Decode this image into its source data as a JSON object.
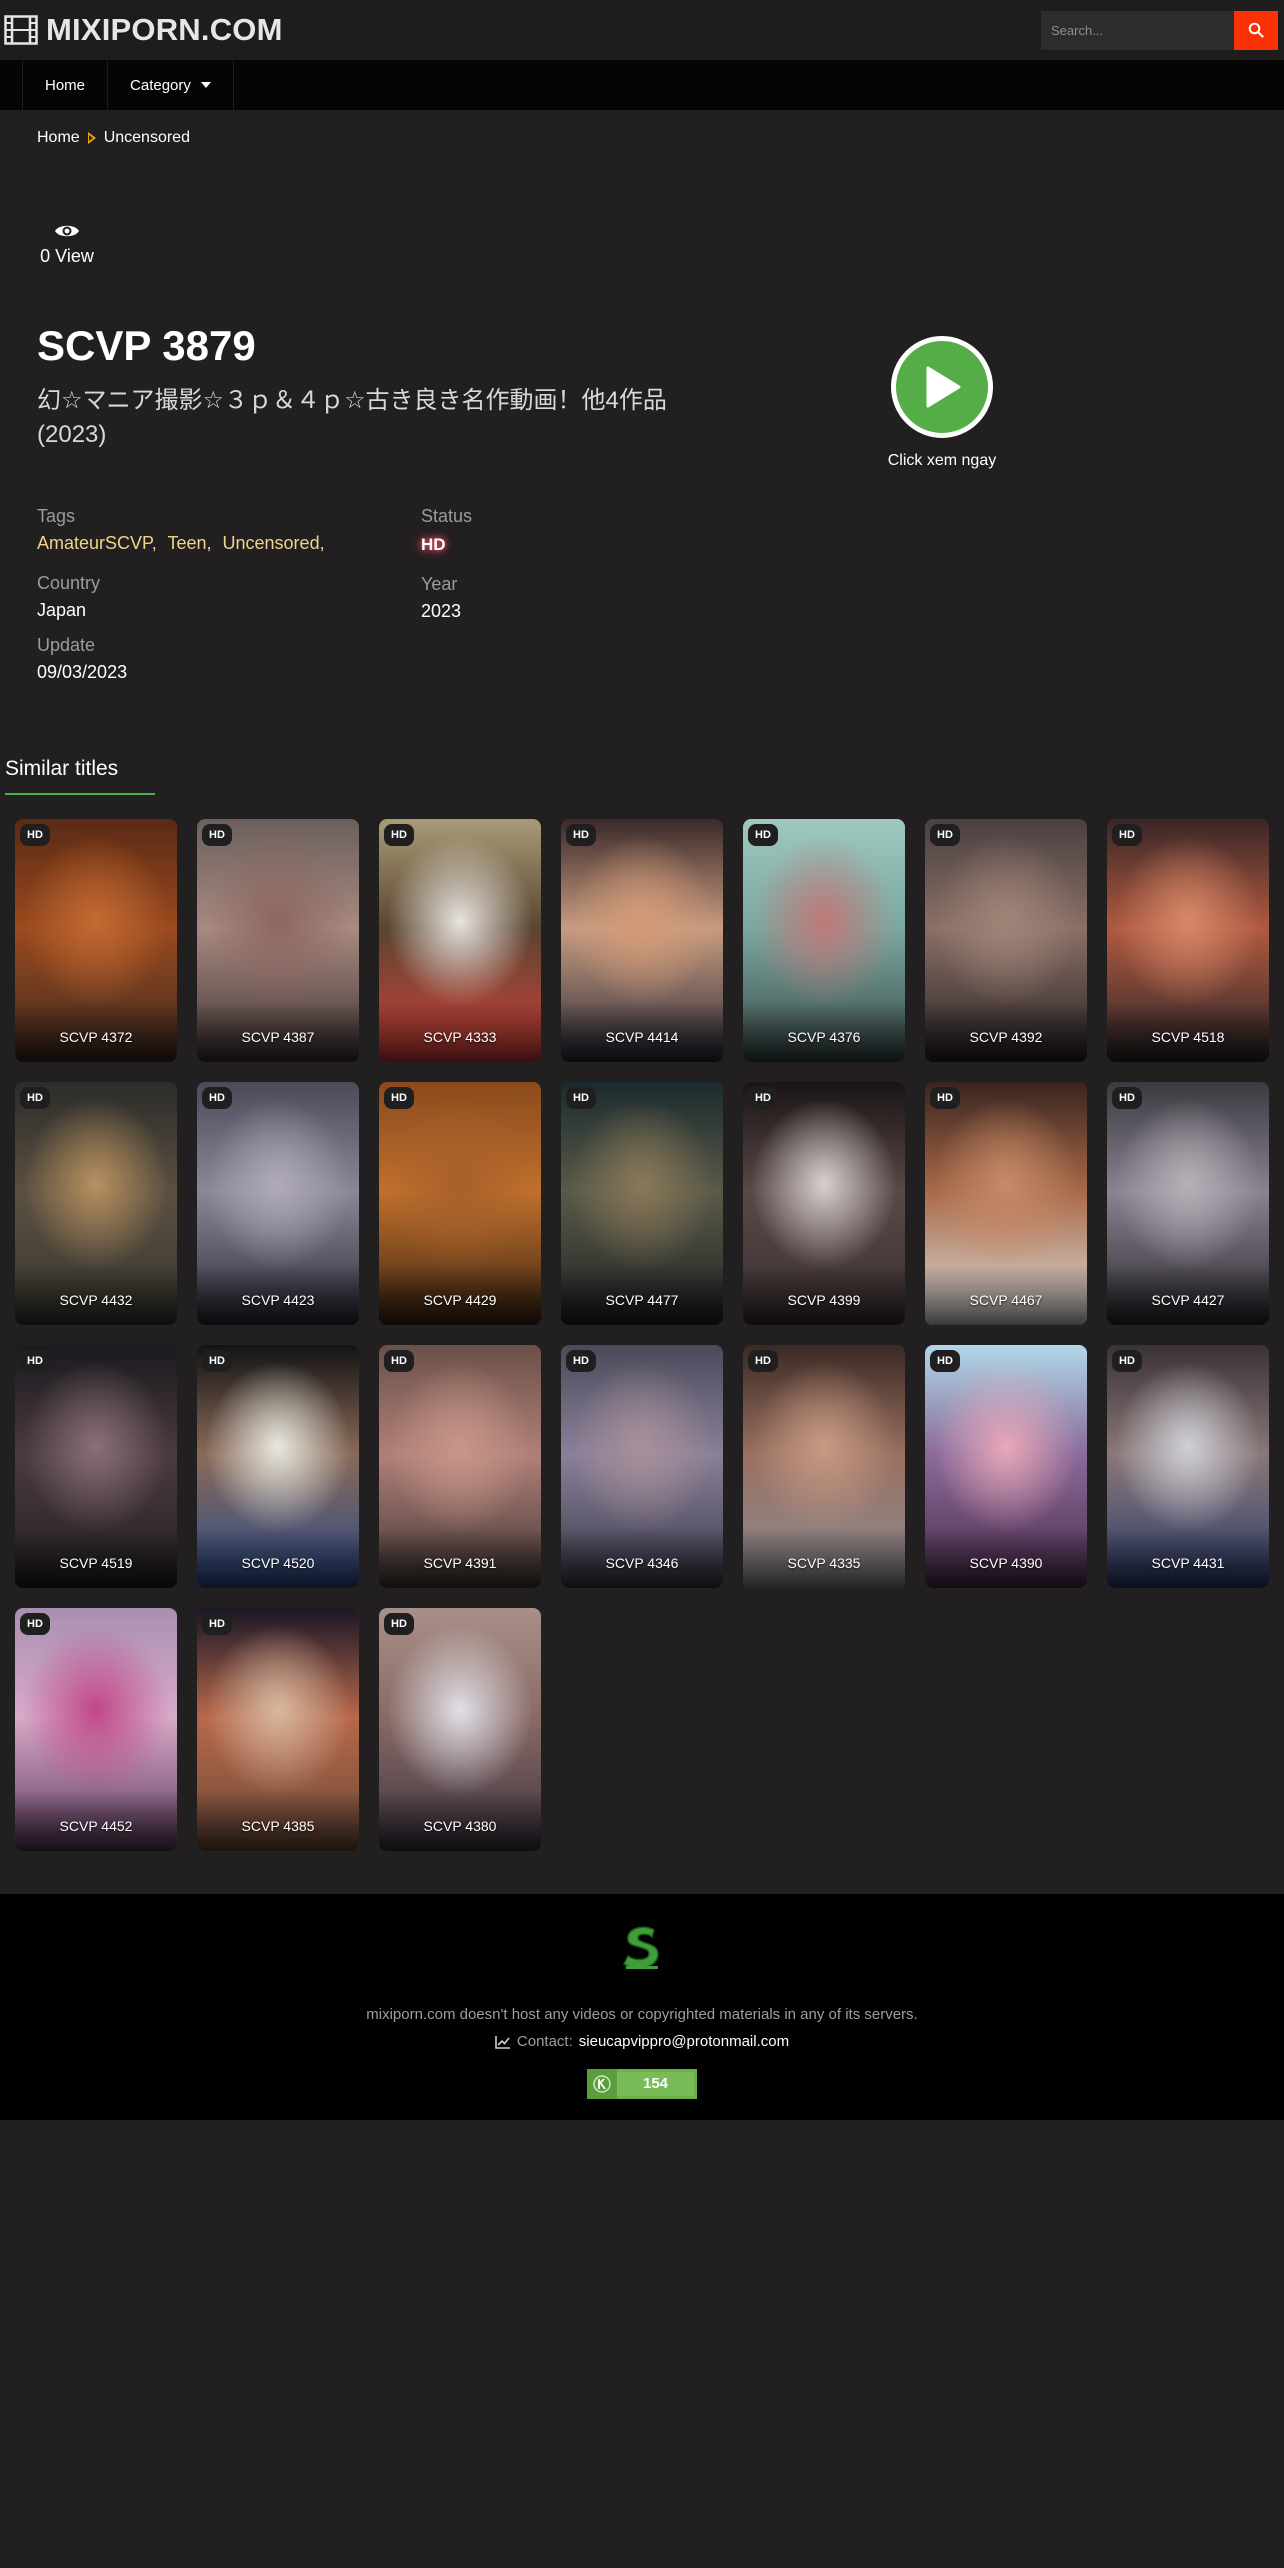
{
  "header": {
    "logo_text": "MIXIPORN.COM",
    "logo_icon": "film-icon",
    "search_placeholder": "Search...",
    "search_icon": "search-icon",
    "accent_color": "#fa3203"
  },
  "nav": {
    "items": [
      {
        "label": "Home"
      },
      {
        "label": "Category"
      }
    ]
  },
  "breadcrumb": {
    "home": "Home",
    "current": "Uncensored"
  },
  "movie": {
    "views": "0 View",
    "title": "SCVP 3879",
    "subtitle": "幻☆マニア撮影☆３ｐ＆４ｐ☆古き良き名作動画！他4作品 (2023)",
    "play_label": "Click xem ngay",
    "tags_label": "Tags",
    "tags": [
      "AmateurSCVP",
      "Teen",
      "Uncensored"
    ],
    "status_label": "Status",
    "status": "HD",
    "country_label": "Country",
    "country": "Japan",
    "year_label": "Year",
    "year": "2023",
    "update_label": "Update",
    "update": "09/03/2023"
  },
  "similar": {
    "heading": "Similar titles",
    "badge": "HD",
    "items": [
      {
        "title": "SCVP 4372",
        "colors": [
          "#5a2a14",
          "#9a4a1e",
          "#c46a32",
          "#3d2a22"
        ]
      },
      {
        "title": "SCVP 4387",
        "colors": [
          "#6b5f5c",
          "#a88a80",
          "#8c6660",
          "#3e3233"
        ]
      },
      {
        "title": "SCVP 4333",
        "colors": [
          "#a89b78",
          "#5a4530",
          "#e8e4e0",
          "#d8403a"
        ]
      },
      {
        "title": "SCVP 4414",
        "colors": [
          "#3a2a2a",
          "#c89c80",
          "#d49a78",
          "#2a2a38"
        ]
      },
      {
        "title": "SCVP 4376",
        "colors": [
          "#9ec8c0",
          "#7aa8a0",
          "#c07878",
          "#3a4848"
        ]
      },
      {
        "title": "SCVP 4392",
        "colors": [
          "#4a4040",
          "#8a7066",
          "#a08478",
          "#262024"
        ]
      },
      {
        "title": "SCVP 4518",
        "colors": [
          "#3a2626",
          "#b05a40",
          "#d88868",
          "#2a2428"
        ]
      },
      {
        "title": "SCVP 4432",
        "colors": [
          "#2c2c2a",
          "#5a5040",
          "#b89060",
          "#383630"
        ]
      },
      {
        "title": "SCVP 4423",
        "colors": [
          "#4a4a5a",
          "#8a8898",
          "#b0aab8",
          "#2a2a36"
        ]
      },
      {
        "title": "SCVP 4429",
        "colors": [
          "#8a4a1e",
          "#c0702c",
          "#a8602a",
          "#3a2412"
        ]
      },
      {
        "title": "SCVP 4477",
        "colors": [
          "#1a2a2e",
          "#5a5a48",
          "#8a7858",
          "#1e2224"
        ]
      },
      {
        "title": "SCVP 4399",
        "colors": [
          "#1a1414",
          "#5a4848",
          "#d8d0d0",
          "#3a3030"
        ]
      },
      {
        "title": "SCVP 4467",
        "colors": [
          "#3a2420",
          "#a86a48",
          "#c88a68",
          "#e0e0e0"
        ]
      },
      {
        "title": "SCVP 4427",
        "colors": [
          "#3a3a40",
          "#8a8290",
          "#b8b0b8",
          "#2a282e"
        ]
      },
      {
        "title": "SCVP 4519",
        "colors": [
          "#1a1a1e",
          "#4a3a40",
          "#8a7078",
          "#222024"
        ]
      },
      {
        "title": "SCVP 4520",
        "colors": [
          "#141414",
          "#8a6a58",
          "#e8e8e0",
          "#2a4a8a"
        ]
      },
      {
        "title": "SCVP 4391",
        "colors": [
          "#6a5048",
          "#b08078",
          "#c8968a",
          "#403634"
        ]
      },
      {
        "title": "SCVP 4346",
        "colors": [
          "#4a4a5a",
          "#8a8098",
          "#a8909a",
          "#383848"
        ]
      },
      {
        "title": "SCVP 4335",
        "colors": [
          "#3a2a24",
          "#9a7060",
          "#c89a84",
          "#8a8a94"
        ]
      },
      {
        "title": "SCVP 4390",
        "colors": [
          "#b0d8e8",
          "#8a6a9a",
          "#e8a8b8",
          "#4a2a4a"
        ]
      },
      {
        "title": "SCVP 4431",
        "colors": [
          "#3a3236",
          "#8a7878",
          "#d0d0d8",
          "#2a3a6a"
        ]
      },
      {
        "title": "SCVP 4452",
        "colors": [
          "#a890b0",
          "#d8a8c8",
          "#c04888",
          "#5a3a5a"
        ]
      },
      {
        "title": "SCVP 4385",
        "colors": [
          "#1a1626",
          "#b8684a",
          "#d8b8a0",
          "#6a4a38"
        ]
      },
      {
        "title": "SCVP 4380",
        "colors": [
          "#a89088",
          "#8a6a66",
          "#e0e0e8",
          "#3a3440"
        ]
      }
    ]
  },
  "footer": {
    "logo_icon": "brand-s-logo-icon",
    "disclaimer": "mixiporn.com doesn't host any videos or copyrighted materials in any of its servers.",
    "contact_label": "Contact:",
    "contact_email": "sieucapvippro@protonmail.com",
    "counter_value": "154"
  }
}
